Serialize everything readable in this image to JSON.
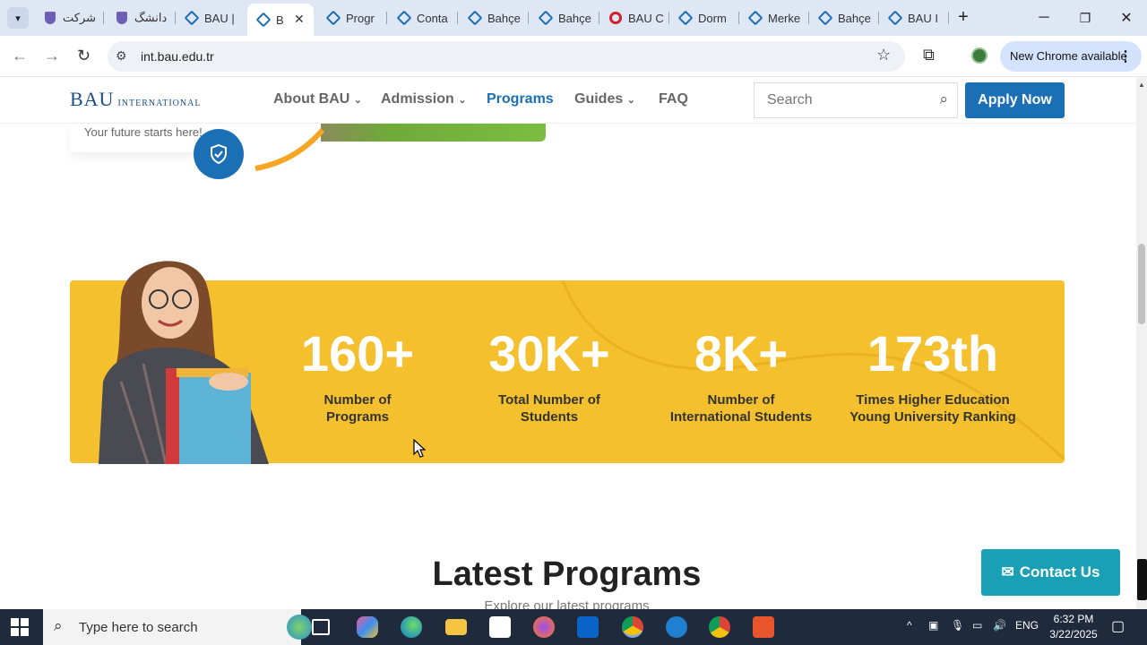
{
  "browser": {
    "tabs": [
      {
        "label": "شركت",
        "icon": "shield-favicon"
      },
      {
        "label": "دانشگ",
        "icon": "shield-favicon"
      },
      {
        "label": "BAU |",
        "icon": "bau-favicon"
      },
      {
        "label": "B",
        "icon": "bau-favicon",
        "active": true
      },
      {
        "label": "Progr",
        "icon": "bau-favicon"
      },
      {
        "label": "Conta",
        "icon": "bau-favicon"
      },
      {
        "label": "Bahçe",
        "icon": "bau-favicon"
      },
      {
        "label": "Bahçe",
        "icon": "bau-favicon"
      },
      {
        "label": "BAU C",
        "icon": "opera-favicon"
      },
      {
        "label": "Dorm",
        "icon": "bau-favicon"
      },
      {
        "label": "Merke",
        "icon": "bau-favicon"
      },
      {
        "label": "Bahçe",
        "icon": "bau-favicon"
      },
      {
        "label": "BAU I",
        "icon": "bau-favicon"
      }
    ],
    "url": "int.bau.edu.tr",
    "new_chrome_label": "New Chrome available"
  },
  "site": {
    "logo_main": "BAU",
    "logo_sub": "INTERNATIONAL",
    "nav": [
      {
        "label": "About BAU",
        "dropdown": true
      },
      {
        "label": "Admission",
        "dropdown": true
      },
      {
        "label": "Programs",
        "dropdown": false,
        "active": true
      },
      {
        "label": "Guides",
        "dropdown": true
      },
      {
        "label": "FAQ",
        "dropdown": false
      }
    ],
    "search_placeholder": "Search",
    "apply_label": "Apply Now",
    "tagline": "Your future starts here!",
    "stats": [
      {
        "value": "160+",
        "label_line1": "Number of",
        "label_line2": "Programs"
      },
      {
        "value": "30K+",
        "label_line1": "Total Number of",
        "label_line2": "Students"
      },
      {
        "value": "8K+",
        "label_line1": "Number of",
        "label_line2": "International Students"
      },
      {
        "value": "173th",
        "label_line1": "Times Higher Education",
        "label_line2": "Young University Ranking"
      }
    ],
    "latest_title": "Latest Programs",
    "latest_subtitle": "Explore our latest programs",
    "contact_label": "Contact Us",
    "colors": {
      "primary": "#1b6fb5",
      "accent": "#f4c02d",
      "contact": "#1aa0b5"
    }
  },
  "taskbar": {
    "search_placeholder": "Type here to search",
    "language": "ENG",
    "time": "6:32 PM",
    "date": "3/22/2025"
  }
}
